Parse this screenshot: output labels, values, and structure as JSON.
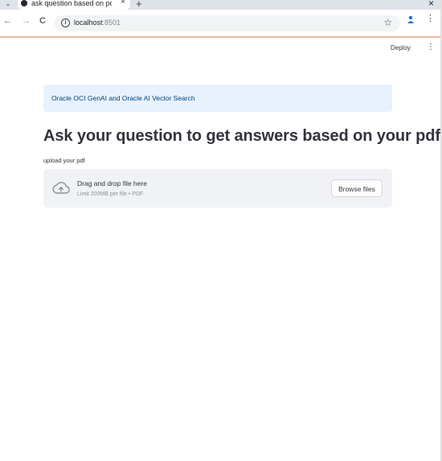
{
  "browser": {
    "tab": {
      "title": "ask question based on pd",
      "close_glyph": "×",
      "favicon": "streamlit-icon"
    },
    "tab_dropdown_glyph": "⌄",
    "new_tab_glyph": "+",
    "window_close_glyph": "×",
    "nav": {
      "back": "←",
      "forward": "→",
      "reload": "C"
    },
    "url": {
      "host": "localhost",
      "port": ":8501"
    },
    "star_glyph": "☆",
    "menu_glyph": "⋮"
  },
  "app": {
    "deploy_label": "Deploy",
    "menu_glyph": "⋮",
    "info_text": "Oracle OCI GenAI and Oracle AI Vector Search",
    "title": "Ask your question to get answers based on your pdf",
    "uploader": {
      "label": "upload your pdf",
      "drop_text": "Drag and drop file here",
      "limit_text": "Limit 200MB per file • PDF",
      "browse_label": "Browse files"
    }
  },
  "colors": {
    "info_bg": "#e8f2fc",
    "info_text": "#004280",
    "dropzone_bg": "#f0f2f6",
    "text": "#31333f",
    "profile_accent": "#1a73e8"
  }
}
